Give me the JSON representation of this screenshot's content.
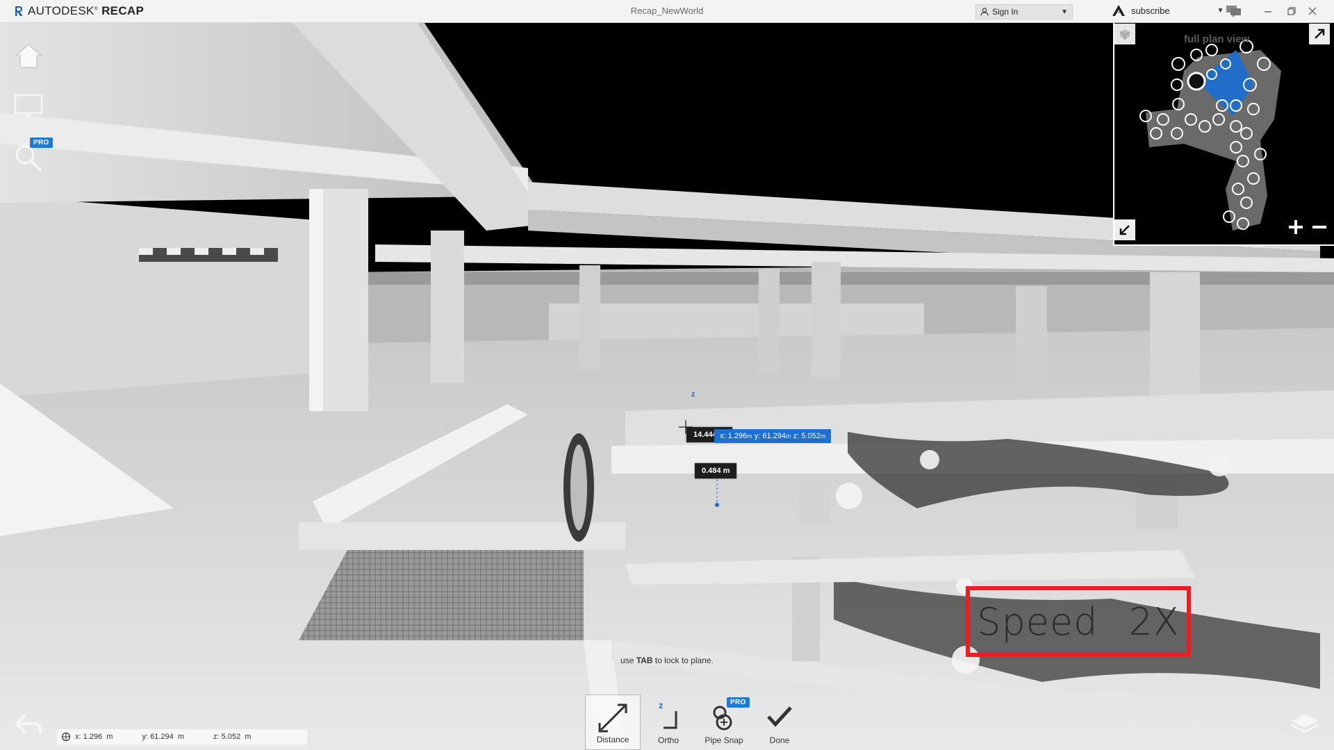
{
  "app": {
    "brand_name": "AUTODESK",
    "brand_product": "RECAP",
    "document_title": "Recap_NewWorld"
  },
  "account": {
    "sign_in_label": "Sign In",
    "subscribe_label": "subscribe"
  },
  "left_tools": {
    "pro_label": "PRO"
  },
  "minimap": {
    "label": "full plan view"
  },
  "measurement": {
    "distance_label": "14.444 m",
    "height_label": "0.484 m",
    "coords_x": "1.296",
    "coords_y": "61.294",
    "coords_z": "5.052",
    "unit": "m",
    "axis_marker": "z"
  },
  "hint": {
    "prefix": "use ",
    "key": "TAB",
    "suffix": " to lock to plane."
  },
  "toolbar": {
    "distance_label": "Distance",
    "ortho_label": "Ortho",
    "pipe_snap_label": "Pipe Snap",
    "pro_label": "PRO",
    "done_label": "Done",
    "ortho_axis": "z"
  },
  "status_coords": {
    "x_label": "x:",
    "x_value": "1.296",
    "y_label": "y:",
    "y_value": "61.294",
    "z_label": "z:",
    "z_value": "5.052",
    "unit": "m"
  },
  "overlay": {
    "speed_word": "Speed",
    "speed_value": "2X"
  },
  "colors": {
    "pro_blue": "#1f7ad6",
    "measure_blue": "#1d6fd0",
    "overlay_red": "#ee1c24"
  }
}
